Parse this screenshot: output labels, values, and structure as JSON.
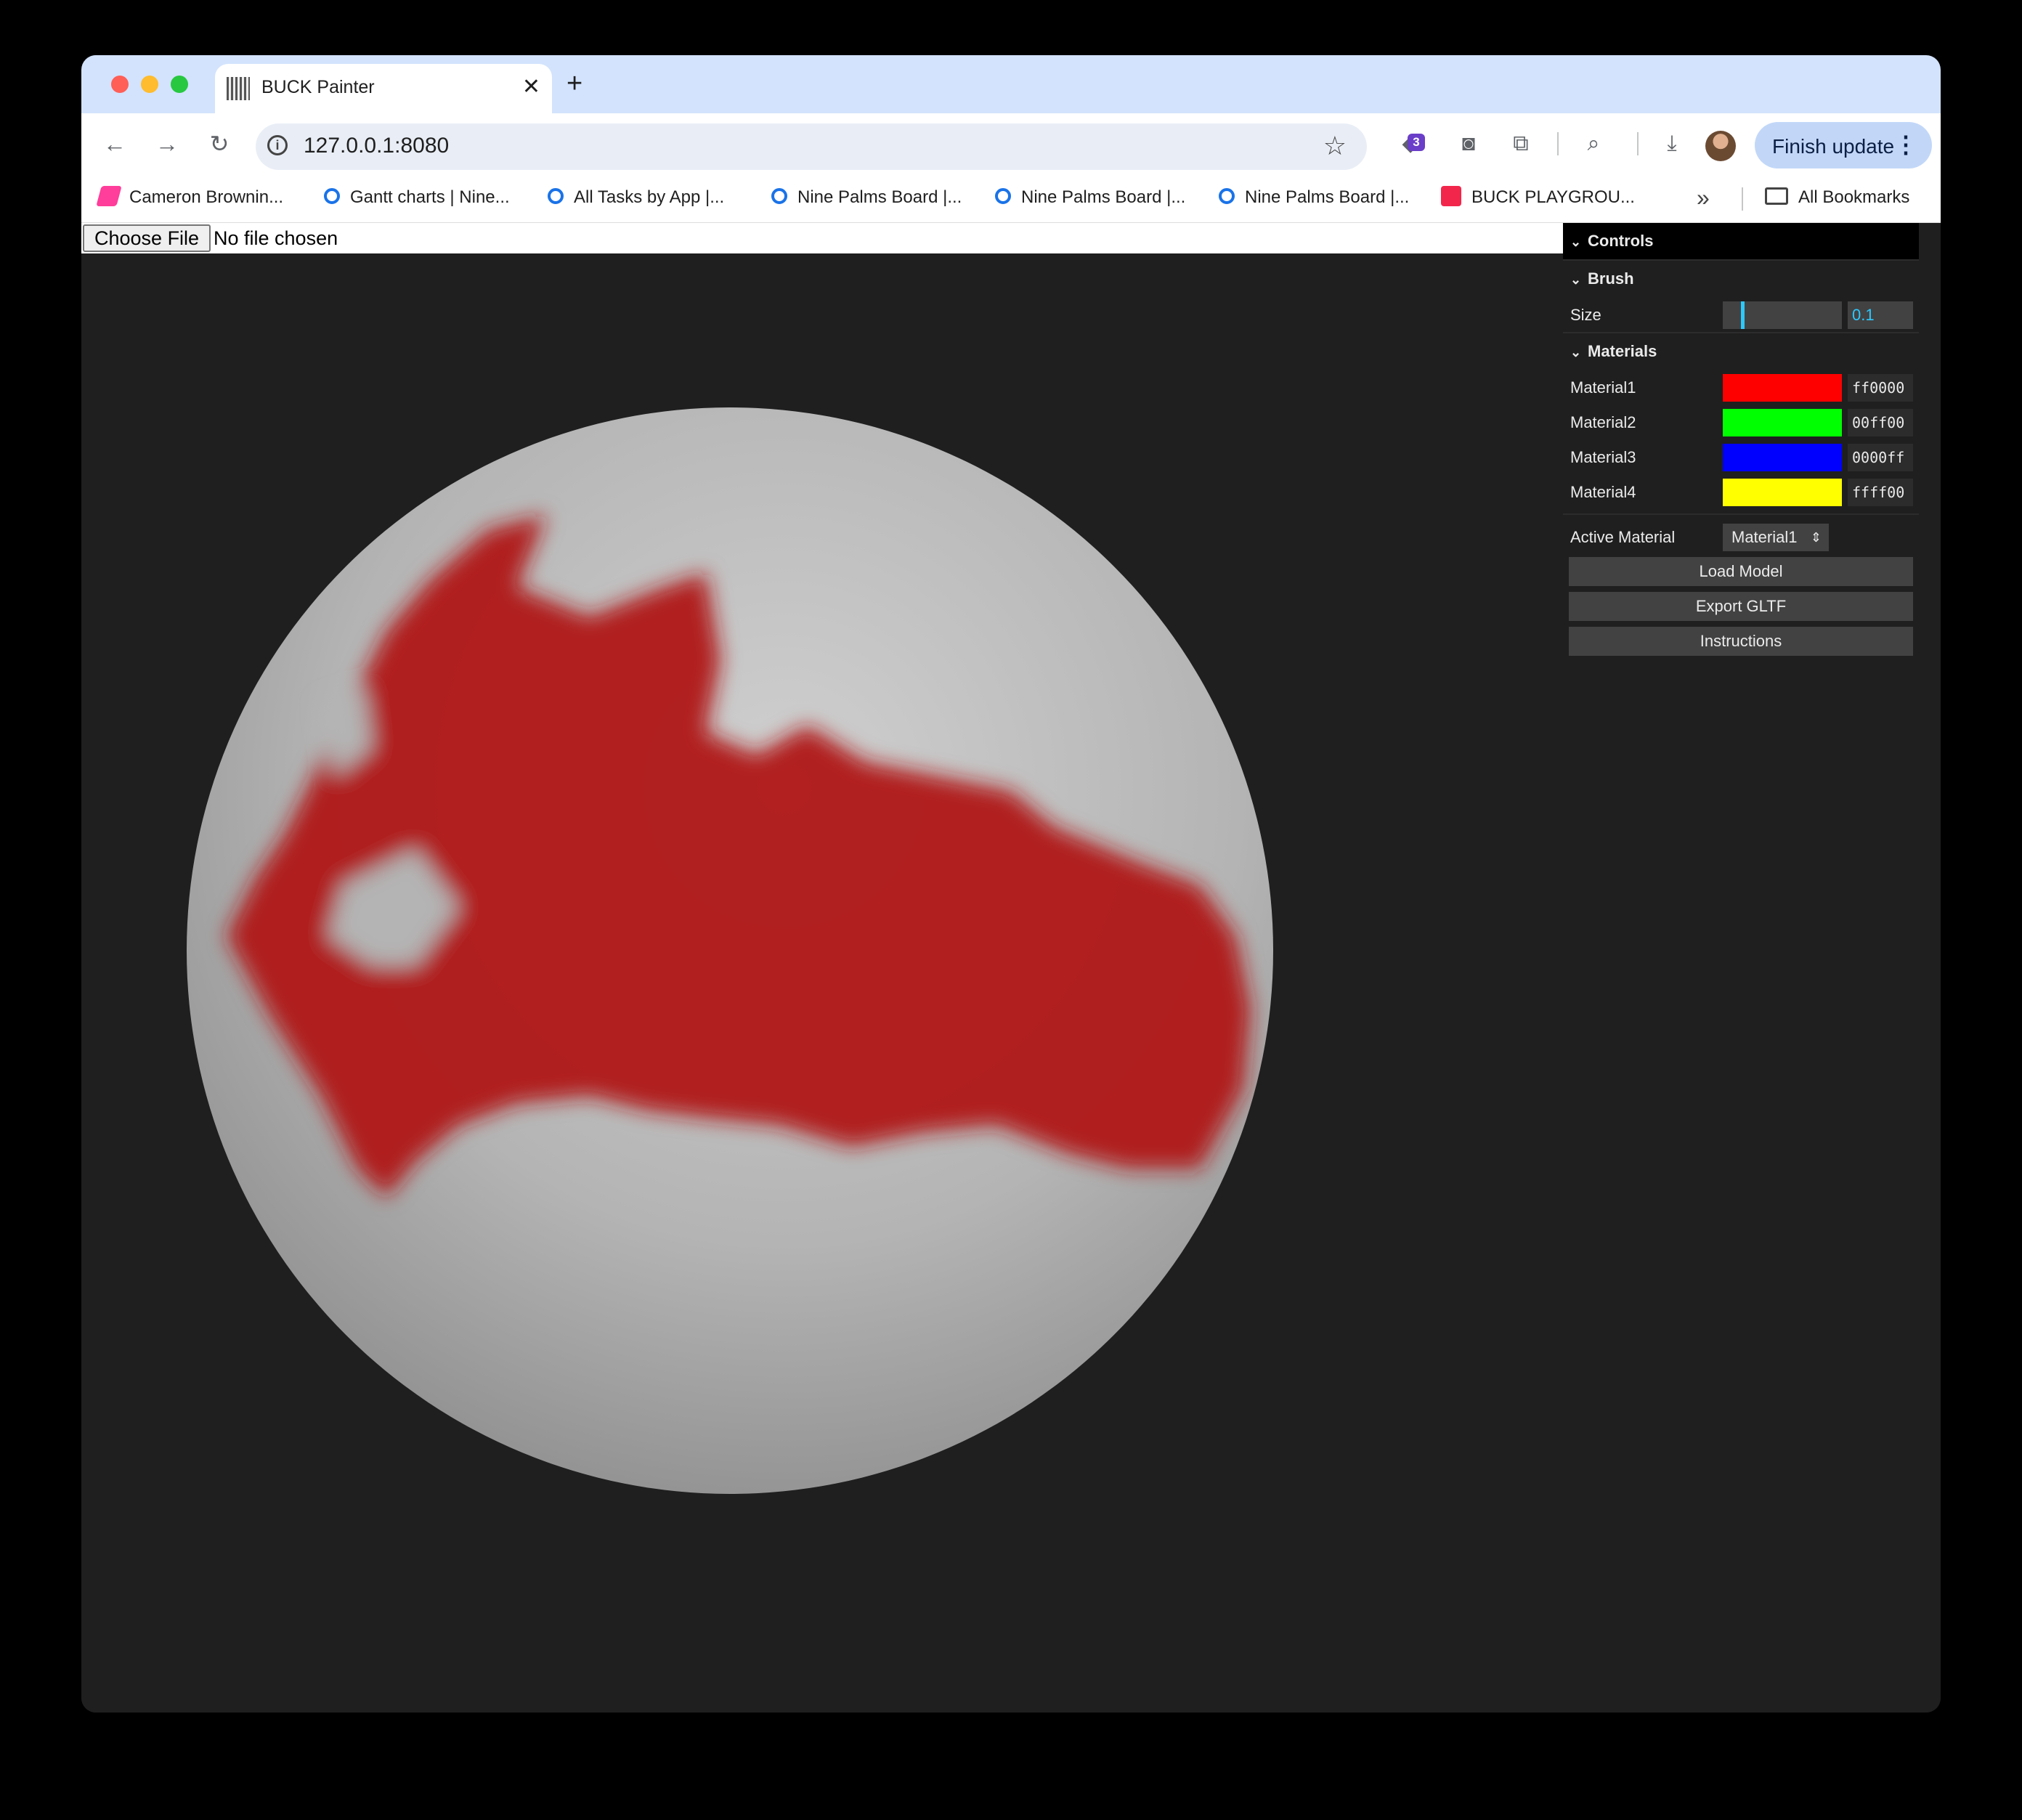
{
  "browser": {
    "tab_title": "BUCK Painter",
    "tab_close_glyph": "✕",
    "new_tab_glyph": "+",
    "url": "127.0.0.1:8080",
    "extension_badge": "3",
    "finish_update_label": "Finish update",
    "bookmarks": [
      {
        "label": "Cameron Brownin...",
        "icon": "pink-logo-icon"
      },
      {
        "label": "Gantt charts | Nine...",
        "icon": "link-icon"
      },
      {
        "label": "All Tasks by App |...",
        "icon": "link-icon"
      },
      {
        "label": "Nine Palms Board |...",
        "icon": "link-icon"
      },
      {
        "label": "Nine Palms Board |...",
        "icon": "link-icon"
      },
      {
        "label": "Nine Palms Board |...",
        "icon": "link-icon"
      },
      {
        "label": "BUCK PLAYGROU...",
        "icon": "red-app-icon"
      }
    ],
    "all_bookmarks_label": "All Bookmarks"
  },
  "page": {
    "choose_file_label": "Choose File",
    "no_file_text": "No file chosen"
  },
  "gui": {
    "title": "Controls",
    "brush_folder": "Brush",
    "size_label": "Size",
    "size_value": "0.1",
    "size_fraction": 0.1,
    "materials_folder": "Materials",
    "materials": [
      {
        "label": "Material1",
        "hex": "ff0000",
        "color": "#ff0000"
      },
      {
        "label": "Material2",
        "hex": "00ff00",
        "color": "#00ff00"
      },
      {
        "label": "Material3",
        "hex": "0000ff",
        "color": "#0000ff"
      },
      {
        "label": "Material4",
        "hex": "ffff00",
        "color": "#ffff00"
      }
    ],
    "active_material_label": "Active Material",
    "active_material_value": "Material1",
    "buttons": {
      "load_model": "Load Model",
      "export_gltf": "Export GLTF",
      "instructions": "Instructions"
    }
  },
  "scene": {
    "background_color": "#1f1f1f",
    "sphere_color": "#bdbdbd",
    "paint_color": "#b01515"
  }
}
